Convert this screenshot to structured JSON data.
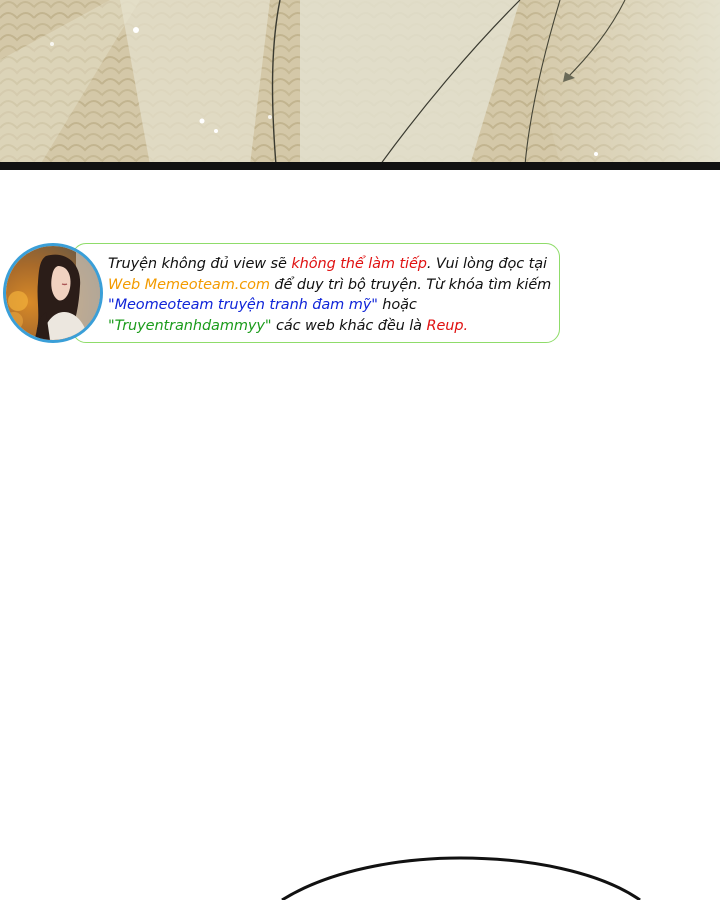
{
  "notice": {
    "line1": {
      "part1": "Truyện không đủ view sẽ ",
      "part2": "không thể làm tiếp",
      "part3": ". Vui lòng đọc tại"
    },
    "line2": {
      "part1": "Web Memeoteam.com",
      "part2": " để duy trì bộ truyện. Từ khóa tìm kiếm"
    },
    "line3": {
      "part1": "\"Meomeoteam truyện tranh đam mỹ\"",
      "part2": " hoặc"
    },
    "line4": {
      "part1": "\"Truyentranhdammyy\"",
      "part2": " các web khác đều là ",
      "part3": "Reup."
    }
  },
  "colors": {
    "warning_red": "#e01212",
    "site_orange": "#f39b00",
    "keyword_blue": "#1025d8",
    "keyword_green": "#1c9c1c",
    "border_green": "#8fdc6a",
    "avatar_ring": "#3a9fd8"
  }
}
